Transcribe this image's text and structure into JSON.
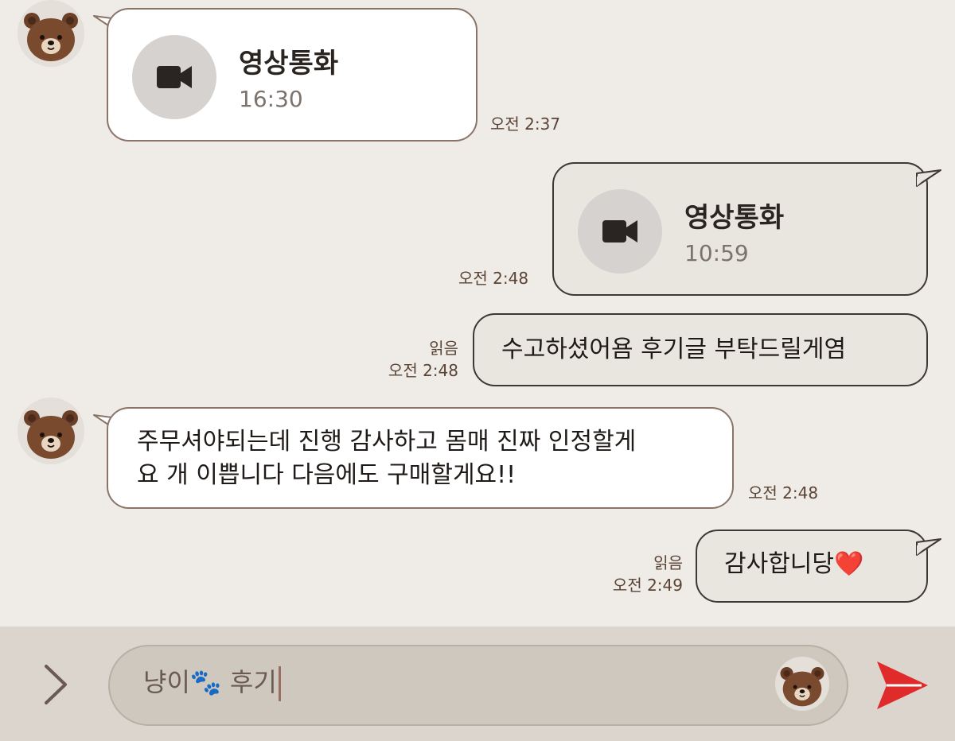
{
  "messages": [
    {
      "type": "call",
      "direction": "incoming",
      "title": "영상통화",
      "duration": "16:30",
      "time": "오전 2:37"
    },
    {
      "type": "call",
      "direction": "outgoing",
      "title": "영상통화",
      "duration": "10:59",
      "time": "오전 2:48"
    },
    {
      "type": "text",
      "direction": "outgoing",
      "text": "수고하셨어욤 후기글 부탁드릴게염",
      "read": "읽음",
      "time": "오전 2:48"
    },
    {
      "type": "text",
      "direction": "incoming",
      "lines": [
        "주무셔야되는데 진행 감사하고 몸매 진짜 인정할게",
        "요 개 이쁩니다 다음에도 구매할게요!!"
      ],
      "time": "오전 2:48"
    },
    {
      "type": "text",
      "direction": "outgoing",
      "text": "감사합니당",
      "emoji": "❤️",
      "read": "읽음",
      "time": "오전 2:49"
    }
  ],
  "input": {
    "text": "냥이🐾 후기"
  },
  "icons": {
    "avatar": "brown-bear-avatar-icon",
    "call": "video-camera-icon",
    "expand": "chevron-right-icon",
    "sticker": "brown-bear-sticker-icon",
    "send": "send-arrow-icon"
  },
  "colors": {
    "background": "#efebe6",
    "incoming_bubble": "#ffffff",
    "outgoing_bubble": "#e9e5df",
    "input_bar": "#dcd5cd",
    "send": "#e02b2b"
  }
}
